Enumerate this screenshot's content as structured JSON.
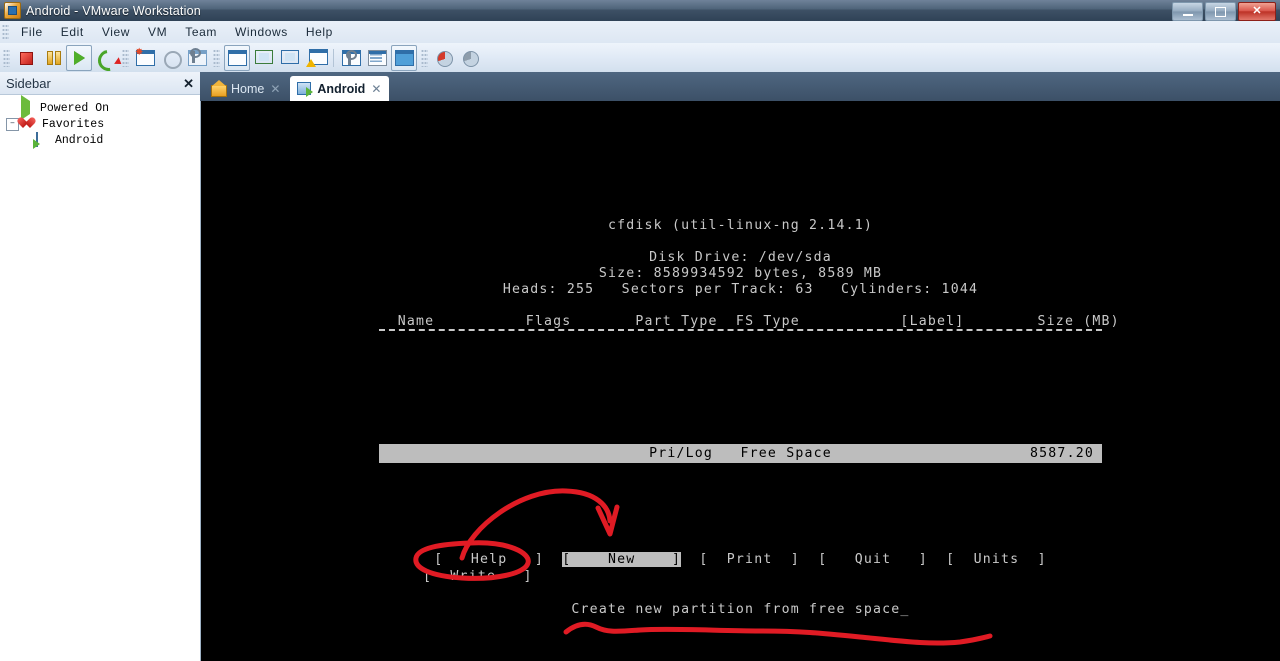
{
  "window": {
    "title": "Android - VMware Workstation",
    "icon": "vmware-app-icon",
    "controls": {
      "minimize": "–",
      "maximize": "❐",
      "close": "✕"
    }
  },
  "menubar": {
    "items": [
      {
        "label": "File",
        "name": "menu-file"
      },
      {
        "label": "Edit",
        "name": "menu-edit"
      },
      {
        "label": "View",
        "name": "menu-view"
      },
      {
        "label": "VM",
        "name": "menu-vm"
      },
      {
        "label": "Team",
        "name": "menu-team"
      },
      {
        "label": "Windows",
        "name": "menu-windows"
      },
      {
        "label": "Help",
        "name": "menu-help"
      }
    ]
  },
  "toolbar": {
    "buttons": [
      {
        "name": "power-off-icon",
        "title": "Power Off"
      },
      {
        "name": "suspend-icon",
        "title": "Suspend"
      },
      {
        "name": "power-on-icon",
        "title": "Power On"
      },
      {
        "name": "reset-icon",
        "title": "Reset"
      },
      {
        "name": "snapshot-take-icon",
        "title": "Take Snapshot"
      },
      {
        "name": "snapshot-revert-icon",
        "title": "Revert Snapshot"
      },
      {
        "name": "snapshot-manager-icon",
        "title": "Snapshot Manager"
      },
      {
        "name": "console-view-icon",
        "title": "Console View"
      },
      {
        "name": "quick-switch-icon",
        "title": "Quick Switch"
      },
      {
        "name": "fullscreen-icon",
        "title": "Full Screen"
      },
      {
        "name": "unity-icon",
        "title": "Unity"
      },
      {
        "name": "settings-icon",
        "title": "Settings"
      },
      {
        "name": "summary-icon",
        "title": "Summary"
      },
      {
        "name": "show-console-icon",
        "title": "Show Console"
      },
      {
        "name": "record-icon",
        "title": "Record"
      },
      {
        "name": "replay-icon",
        "title": "Replay"
      }
    ]
  },
  "sidebar": {
    "title": "Sidebar",
    "close_label": "✕",
    "items": [
      {
        "label": "Powered On",
        "icon": "powered-on-icon",
        "indent": 1,
        "expander": ""
      },
      {
        "label": "Favorites",
        "icon": "favorites-heart-icon",
        "indent": 0,
        "expander": "–"
      },
      {
        "label": "Android",
        "icon": "vm-android-icon",
        "indent": 2,
        "expander": ""
      }
    ]
  },
  "tabs": [
    {
      "label": "Home",
      "icon": "home-icon",
      "active": false,
      "close": "✕"
    },
    {
      "label": "Android",
      "icon": "vm-android-icon",
      "active": true,
      "close": "✕"
    }
  ],
  "terminal": {
    "app_title": "cfdisk (util-linux-ng 2.14.1)",
    "disk_drive": "Disk Drive: /dev/sda",
    "size": "Size: 8589934592 bytes, 8589 MB",
    "geometry": "Heads: 255   Sectors per Track: 63   Cylinders: 1044",
    "table_header": "    Name          Flags       Part Type  FS Type           [Label]        Size (MB)",
    "row": {
      "name": "",
      "flags": "",
      "part_type": "Pri/Log",
      "fs_type": "Free Space",
      "label": "",
      "size": "8587.20",
      "selected": true
    },
    "buttons_row1": [
      {
        "label": "Help",
        "bracket_open": "[",
        "bracket_close": "]",
        "highlighted": false
      },
      {
        "label": "New",
        "bracket_open": "[",
        "bracket_close": "]",
        "highlighted": true
      },
      {
        "label": "Print",
        "bracket_open": "[",
        "bracket_close": "]",
        "highlighted": false
      },
      {
        "label": "Quit",
        "bracket_open": "[",
        "bracket_close": "]",
        "highlighted": false
      },
      {
        "label": "Units",
        "bracket_open": "[",
        "bracket_close": "]",
        "highlighted": false
      }
    ],
    "buttons_row2": [
      {
        "label": "Write",
        "bracket_open": "[",
        "bracket_close": "]",
        "highlighted": false
      }
    ],
    "status": "Create new partition from free space_"
  },
  "annotations": {
    "color": "#e01b24",
    "items": [
      {
        "name": "ellipse-around-help-button",
        "shape": "ellipse"
      },
      {
        "name": "arrow-pointing-to-new-button",
        "shape": "curved-arrow"
      },
      {
        "name": "underline-under-status-text",
        "shape": "squiggly-line"
      }
    ]
  }
}
